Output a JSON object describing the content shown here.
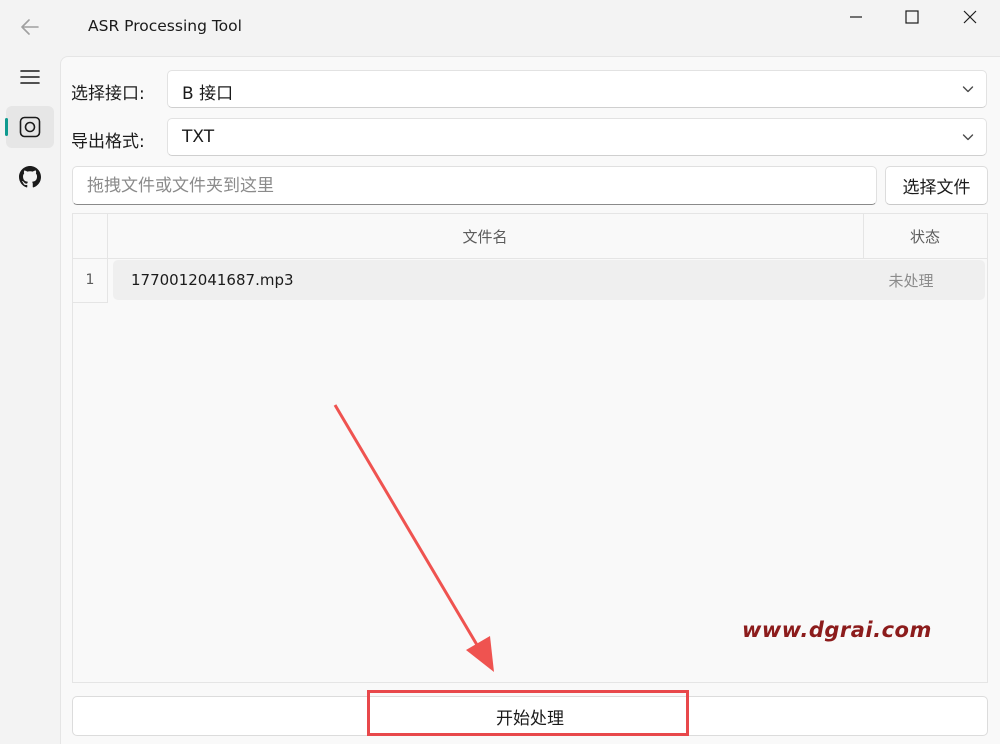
{
  "window": {
    "title": "ASR Processing Tool",
    "controls": [
      "minimize-icon",
      "maximize-icon",
      "close-icon"
    ]
  },
  "nav": {
    "items": [
      {
        "icon": "menu-icon"
      },
      {
        "icon": "recognition-icon",
        "selected": true
      },
      {
        "icon": "github-icon"
      }
    ],
    "accent": "#0f9a8f"
  },
  "form": {
    "api_label": "选择接口:",
    "api_value": "B 接口",
    "format_label": "导出格式:",
    "format_value": "TXT",
    "drop_placeholder": "拖拽文件或文件夹到这里",
    "select_file_label": "选择文件"
  },
  "table": {
    "headers": {
      "name": "文件名",
      "status": "状态"
    },
    "rows": [
      {
        "index": "1",
        "name": "1770012041687.mp3",
        "status": "未处理"
      }
    ]
  },
  "start_button_label": "开始处理",
  "annotation": {
    "watermark": "www.dgrai.com",
    "highlight_color": "#e8484b"
  }
}
